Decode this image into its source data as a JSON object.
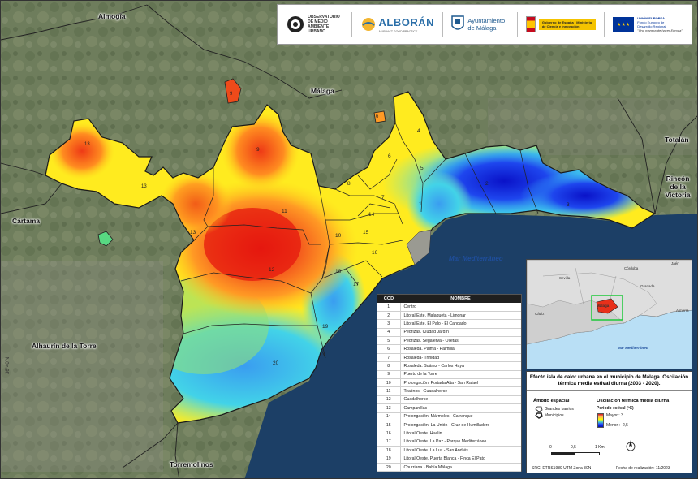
{
  "map": {
    "places": {
      "almogia": "Almogía",
      "malaga": "Málaga",
      "totalan": "Totalán",
      "rincon": "Rincón de la Victoria",
      "cartama": "Cártama",
      "alhaurin": "Alhaurín de la Torre",
      "torremolinos": "Torremolinos"
    },
    "sea_label": "Mar Mediterráneo",
    "coord_label": "36°40'N",
    "districts": [
      "1",
      "2",
      "3",
      "4",
      "5",
      "6",
      "7",
      "8",
      "9",
      "10",
      "11",
      "12",
      "13",
      "14",
      "15",
      "16",
      "17",
      "18",
      "19",
      "20"
    ],
    "heat_colors": {
      "hot": "#e8301a",
      "warm": "#ff8a1e",
      "mild": "#ffe81e",
      "cool": "#32d6e6",
      "cold": "#1028e0"
    }
  },
  "logos": {
    "observatorio": "Observatorio de Medio Ambiente Urbano",
    "alboran": "ALBORÁN",
    "alboran_sub": "A URBACT GOOD PRACTICE",
    "ayuntamiento": "Ayuntamiento de Málaga",
    "gobierno": "Gobierno de España · Ministerio de Ciencia e Innovación",
    "eu_title": "UNIÓN EUROPEA",
    "eu_fund": "Fondo Europeo de Desarrollo Regional",
    "eu_motto": "\"Una manera de hacer Europa\""
  },
  "table": {
    "col_cod": "COD",
    "col_nombre": "NOMBRE",
    "rows": [
      {
        "cod": "1",
        "nombre": "Centro"
      },
      {
        "cod": "2",
        "nombre": "Litoral Este. Malagueta - Limonar"
      },
      {
        "cod": "3",
        "nombre": "Litoral Este. El Palo - El Candado"
      },
      {
        "cod": "4",
        "nombre": "Pedrizas. Ciudad Jardín"
      },
      {
        "cod": "5",
        "nombre": "Pedrizas. Segalerva - Olletas"
      },
      {
        "cod": "6",
        "nombre": "Rosaleda. Palma - Palmilla"
      },
      {
        "cod": "7",
        "nombre": "Rosaleda- Trinidad"
      },
      {
        "cod": "8",
        "nombre": "Rosaleda. Suárez - Carlos Haya"
      },
      {
        "cod": "9",
        "nombre": "Puerto de la Torre"
      },
      {
        "cod": "10",
        "nombre": "Prolongación. Portada Alta - San Rafael"
      },
      {
        "cod": "11",
        "nombre": "Teatinos - Guadalhorce"
      },
      {
        "cod": "12",
        "nombre": "Guadalhorce"
      },
      {
        "cod": "13",
        "nombre": "Campanillas"
      },
      {
        "cod": "14",
        "nombre": "Prolongación. Mármoles - Carranque"
      },
      {
        "cod": "15",
        "nombre": "Prolongación. La Unión - Cruz de Humilladero"
      },
      {
        "cod": "16",
        "nombre": "Litoral Oeste. Huelin"
      },
      {
        "cod": "17",
        "nombre": "Litoral Oeste. La Paz - Parque Mediterráneo"
      },
      {
        "cod": "18",
        "nombre": "Litoral Oeste. La Luz - San Andrés"
      },
      {
        "cod": "19",
        "nombre": "Litoral Oeste. Puerta Blanca - Finca El Pato"
      },
      {
        "cod": "20",
        "nombre": "Churriana - Bahía Málaga"
      }
    ]
  },
  "inset": {
    "labels": {
      "cordoba": "Córdoba",
      "jaen": "Jaén",
      "sevilla": "Sevilla",
      "granada": "Granada",
      "almeria": "Almería",
      "cadiz": "Cádiz",
      "malaga": "Málaga",
      "sea": "Mar Mediterráneo"
    }
  },
  "panel": {
    "title": "Efecto isla de calor urbana en el municipio de Málaga. Oscilación térmica media estival diurna (2003 - 2020).",
    "ambito_h": "Ámbito espacial",
    "ambito_1": "Grandes barrios",
    "ambito_2": "Municipios",
    "osc_h": "Oscilación térmica media diurna",
    "periodo": "Periodo estival (ºC)",
    "mayor": "Mayor : 3",
    "menor": "Menor : -2,5",
    "scale_0": "0",
    "scale_1": "0,5",
    "scale_2": "1 Km",
    "src": "SRC: ETRS1989 UTM Zona 30N",
    "fecha": "Fecha de realización: 11/2023"
  }
}
